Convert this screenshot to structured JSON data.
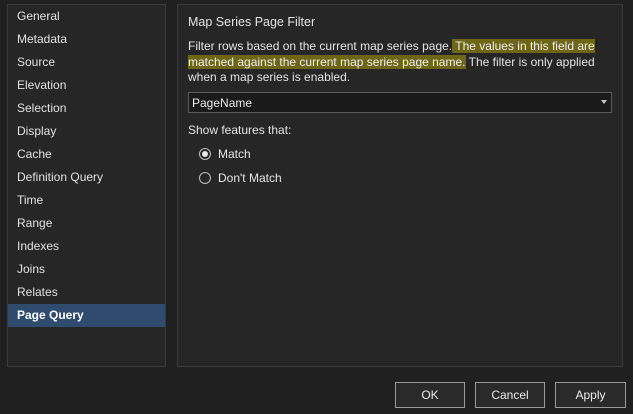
{
  "sidebar": {
    "items": [
      {
        "label": "General"
      },
      {
        "label": "Metadata"
      },
      {
        "label": "Source"
      },
      {
        "label": "Elevation"
      },
      {
        "label": "Selection"
      },
      {
        "label": "Display"
      },
      {
        "label": "Cache"
      },
      {
        "label": "Definition Query"
      },
      {
        "label": "Time"
      },
      {
        "label": "Range"
      },
      {
        "label": "Indexes"
      },
      {
        "label": "Joins"
      },
      {
        "label": "Relates"
      },
      {
        "label": "Page Query"
      }
    ],
    "selected": "Page Query"
  },
  "content": {
    "title": "Map Series Page Filter",
    "description": {
      "part1": "Filter rows based on the current map series page.",
      "highlight1": " The values in this field are",
      "highlight2": "matched against the current map series page name.",
      "part2": " The filter is only applied",
      "part3": "when a map series is enabled."
    },
    "field_select": {
      "value": "PageName"
    },
    "show_label": "Show features that:",
    "radios": [
      {
        "label": "Match",
        "checked": true
      },
      {
        "label": "Don't Match",
        "checked": false
      }
    ]
  },
  "buttons": {
    "ok": "OK",
    "cancel": "Cancel",
    "apply": "Apply"
  },
  "colors": {
    "background": "#202020",
    "panel": "#262626",
    "selected_item": "#2f4b6e",
    "highlight": "#6e6516"
  }
}
